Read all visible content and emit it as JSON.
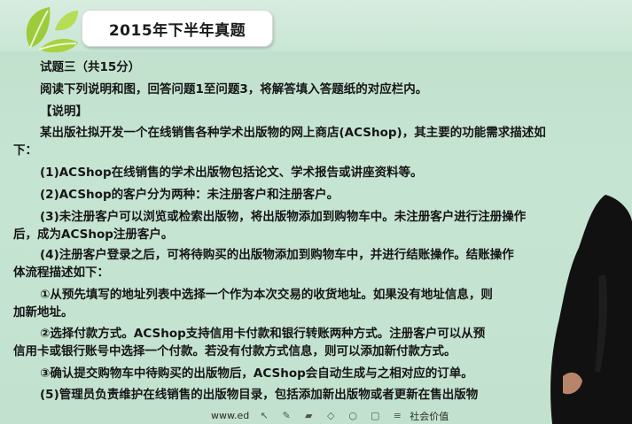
{
  "header": {
    "title": "2015年下半年真题"
  },
  "content": {
    "lines": [
      "试题三（共15分）",
      "阅读下列说明和图，回答问题1至问题3，将解答填入答题纸的对应栏内。",
      "【说明】",
      "某出版社拟开发一个在线销售各种学术出版物的网上商店(ACShop)，其主要的功能需求描述如",
      "下：",
      "(1)ACShop在线销售的学术出版物包括论文、学术报告或讲座资料等。",
      "(2)ACShop的客户分为两种：未注册客户和注册客户。",
      "(3)未注册客户可以浏览或检索出版物，将出版物添加到购物车中。未注册客户进行注册操作",
      "后，成为ACShop注册客户。",
      "(4)注册客户登录之后，可将待购买的出版物添加到购物车中，并进行结账操作。结账操作",
      "体流程描述如下：",
      "①从预先填写的地址列表中选择一个作为本次交易的收货地址。如果没有地址信息，则",
      "加新地址。",
      "②选择付款方式。ACShop支持信用卡付款和银行转账两种方式。注册客户可以从预",
      "信用卡或银行账号中选择一个付款。若没有付款方式信息，则可以添加新付款方式。",
      "③确认提交购物车中待购买的出版物后，ACShop会自动生成与之相对应的订单。",
      "(5)管理员负责维护在线销售的出版物目录，包括添加新出版物或者更新在售出版物"
    ]
  },
  "footer": {
    "url_fragment": "www.ed",
    "slogan_fragment": "社会价值"
  },
  "toolbar": {
    "icons": [
      "cursor-icon",
      "pen-icon",
      "highlighter-icon",
      "eraser-icon",
      "circle-icon",
      "delete-icon",
      "menu-icon"
    ]
  },
  "colors": {
    "background": "#c2e2cf",
    "title_bg": "#ffffff",
    "leaf_green": "#9ccc3a"
  }
}
